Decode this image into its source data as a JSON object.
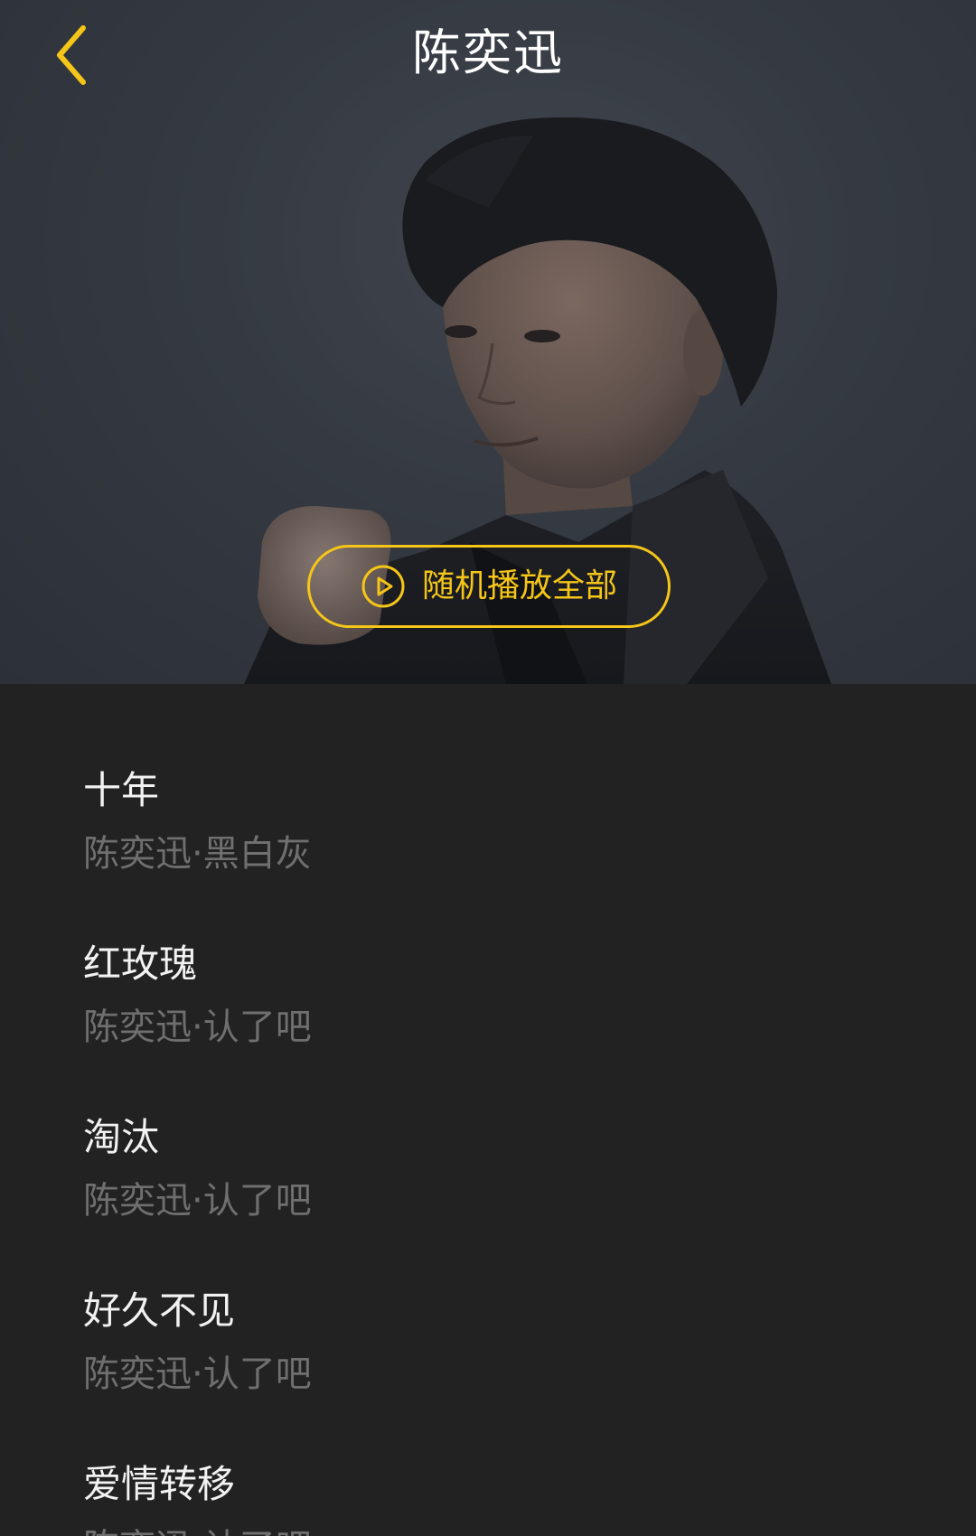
{
  "header": {
    "title": "陈奕迅",
    "back_icon": "chevron-left-icon",
    "accent_color": "#f5c518"
  },
  "hero": {
    "shuffle_label": "随机播放全部",
    "shuffle_icon": "play-circle-icon"
  },
  "songs": [
    {
      "title": "十年",
      "subtitle": "陈奕迅·黑白灰"
    },
    {
      "title": "红玫瑰",
      "subtitle": "陈奕迅·认了吧"
    },
    {
      "title": "淘汰",
      "subtitle": "陈奕迅·认了吧"
    },
    {
      "title": "好久不见",
      "subtitle": "陈奕迅·认了吧"
    },
    {
      "title": "爱情转移",
      "subtitle": "陈奕迅·认了吧"
    }
  ]
}
